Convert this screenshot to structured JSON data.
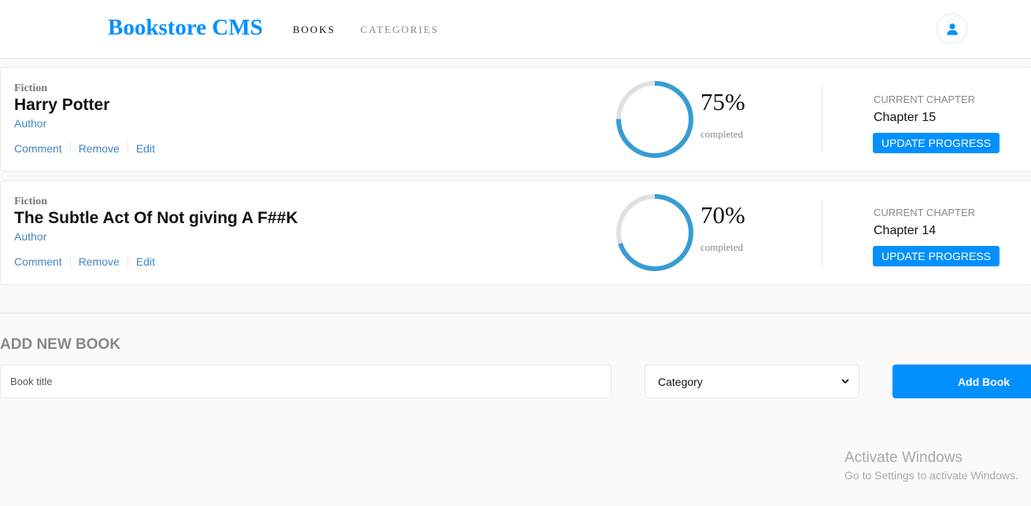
{
  "header": {
    "logo": "Bookstore CMS",
    "nav": [
      "BOOKS",
      "CATEGORIES"
    ]
  },
  "colors": {
    "accent": "#0290ff",
    "progress": "#379cd6",
    "progress_track": "#e0e0e0",
    "link": "#4386bf"
  },
  "books": [
    {
      "genre": "Fiction",
      "title": "Harry Potter",
      "author": "Author",
      "actions": [
        "Comment",
        "Remove",
        "Edit"
      ],
      "progress": 75,
      "progress_label": "75%",
      "completed_label": "completed",
      "chapter_label": "CURRENT CHAPTER",
      "chapter": "Chapter 15",
      "update_label": "UPDATE PROGRESS"
    },
    {
      "genre": "Fiction",
      "title": "The Subtle Act Of Not giving A F##K",
      "author": "Author",
      "actions": [
        "Comment",
        "Remove",
        "Edit"
      ],
      "progress": 70,
      "progress_label": "70%",
      "completed_label": "completed",
      "chapter_label": "CURRENT CHAPTER",
      "chapter": "Chapter 14",
      "update_label": "UPDATE PROGRESS"
    }
  ],
  "form": {
    "title": "ADD NEW BOOK",
    "title_placeholder": "Book title",
    "category_selected": "Category",
    "submit_label": "Add Book"
  },
  "watermark": {
    "title": "Activate Windows",
    "subtitle": "Go to Settings to activate Windows."
  }
}
